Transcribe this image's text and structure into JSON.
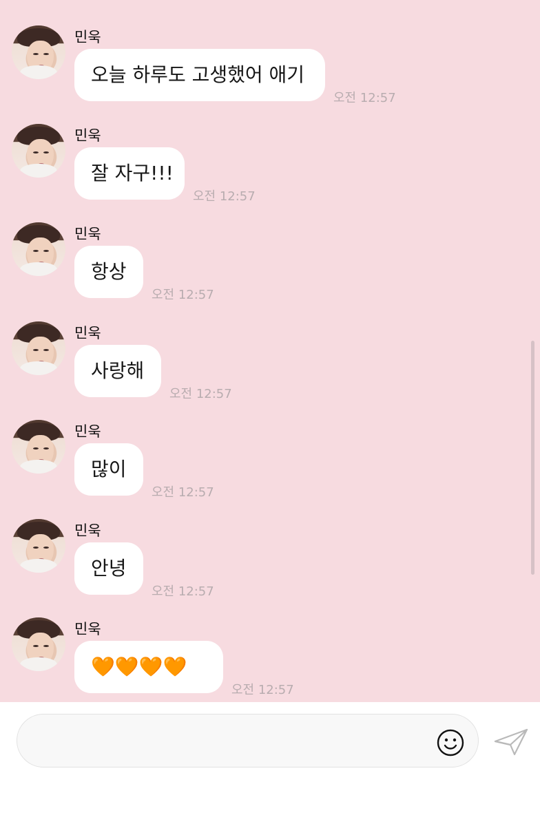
{
  "colors": {
    "chat_background": "#f7dbe0",
    "bubble_background": "#ffffff",
    "timestamp_text": "#b8acaf",
    "name_text": "#111111"
  },
  "messages": [
    {
      "sender": "민욱",
      "text": "오늘 하루도 고생했어 애기",
      "time": "오전 12:57"
    },
    {
      "sender": "민욱",
      "text": "잘 자구!!!",
      "time": "오전 12:57"
    },
    {
      "sender": "민욱",
      "text": "항상",
      "time": "오전 12:57"
    },
    {
      "sender": "민욱",
      "text": "사랑해",
      "time": "오전 12:57"
    },
    {
      "sender": "민욱",
      "text": "많이",
      "time": "오전 12:57"
    },
    {
      "sender": "민욱",
      "text": "안녕",
      "time": "오전 12:57"
    },
    {
      "sender": "민욱",
      "text": "🧡🧡🧡🧡",
      "time": "오전 12:57"
    }
  ],
  "composer": {
    "value": "",
    "placeholder": "",
    "emoji_icon": "smiley-icon",
    "send_icon": "paper-plane-icon"
  }
}
